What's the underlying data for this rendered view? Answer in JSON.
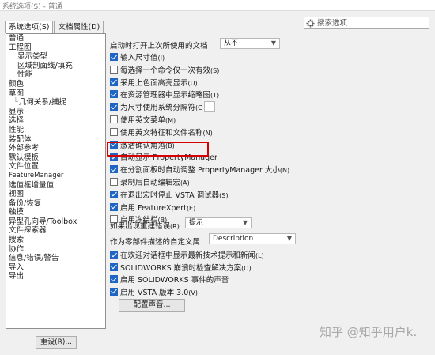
{
  "window": {
    "title": "系统选项(S) - 普通"
  },
  "tabs": [
    {
      "label": "系统选项(S)",
      "active": true
    },
    {
      "label": "文档属性(D)",
      "active": false
    }
  ],
  "search": {
    "placeholder": "搜索选项",
    "icon": "gear-icon"
  },
  "tree": {
    "items": [
      {
        "label": "普通",
        "level": 0
      },
      {
        "label": "工程图",
        "level": 0
      },
      {
        "label": "显示类型",
        "level": 1
      },
      {
        "label": "区域剖面线/填充",
        "level": 1
      },
      {
        "label": "性能",
        "level": 1
      },
      {
        "label": "颜色",
        "level": 0
      },
      {
        "label": "草图",
        "level": 0
      },
      {
        "label": "几何关系/捕捉",
        "level": 1,
        "connector": true
      },
      {
        "label": "显示",
        "level": 0
      },
      {
        "label": "选择",
        "level": 0
      },
      {
        "label": "性能",
        "level": 0
      },
      {
        "label": "装配体",
        "level": 0
      },
      {
        "label": "外部参考",
        "level": 0
      },
      {
        "label": "默认模板",
        "level": 0
      },
      {
        "label": "文件位置",
        "level": 0
      },
      {
        "label": "FeatureManager",
        "level": 0,
        "small": true
      },
      {
        "label": "选值框增量值",
        "level": 0
      },
      {
        "label": "视图",
        "level": 0
      },
      {
        "label": "备份/恢复",
        "level": 0
      },
      {
        "label": "触摸",
        "level": 0
      },
      {
        "label": "异型孔向导/Toolbox",
        "level": 0
      },
      {
        "label": "文件探索器",
        "level": 0
      },
      {
        "label": "搜索",
        "level": 0
      },
      {
        "label": "协作",
        "level": 0
      },
      {
        "label": "信息/错误/警告",
        "level": 0
      },
      {
        "label": "导入",
        "level": 0
      },
      {
        "label": "导出",
        "level": 0
      }
    ],
    "reset_label": "重设(R)..."
  },
  "panel": {
    "open_last_docs_label": "启动时打开上次所使用的文档",
    "open_last_docs_value": "从不",
    "checkboxes": [
      {
        "label": "输入尺寸值",
        "suffix": "(I)",
        "checked": true
      },
      {
        "label": "每选择一个命令仅一次有效",
        "suffix": "(S)",
        "checked": false
      },
      {
        "label": "采用上色面高亮显示",
        "suffix": "(U)",
        "checked": true
      },
      {
        "label": "在资源管理器中显示缩略图",
        "suffix": "(T)",
        "checked": true
      },
      {
        "label": "为尺寸使用系统分隔符",
        "suffix": "(C",
        "checked": true,
        "spin": true
      },
      {
        "label": "使用英文菜单",
        "suffix": "(M)",
        "checked": false
      },
      {
        "label": "使用英文特征和文件名称",
        "suffix": "(N)",
        "checked": false
      },
      {
        "label": "激活确认角落",
        "suffix": "(B)",
        "checked": true
      },
      {
        "label": "自动显示 PropertyManager",
        "suffix": "",
        "checked": true
      },
      {
        "label": "在分割面板时自动调整 PropertyManager 大小",
        "suffix": "(N)",
        "checked": true
      },
      {
        "label": "录制后自动编辑宏",
        "suffix": "(A)",
        "checked": false
      },
      {
        "label": "在退出宏时停止 VSTA 调试器",
        "suffix": "(S)",
        "checked": true
      },
      {
        "label": "启用 FeatureXpert",
        "suffix": "(E)",
        "checked": true
      },
      {
        "label": "启用冻结栏",
        "suffix": "(B)",
        "checked": false
      }
    ],
    "rebuild_error_label": "如果出现重建错误",
    "rebuild_error_suffix": "(R)",
    "rebuild_error_value": "提示",
    "custom_prop_label": "作为零部件描述的自定义属",
    "custom_prop_value": "Description",
    "checkboxes2": [
      {
        "label": "在欢迎对话框中显示最新技术提示和新闻",
        "suffix": "(L)",
        "checked": true
      },
      {
        "label": "SOLIDWORKS 崩溃时检查解决方案",
        "suffix": "(O)",
        "checked": true
      },
      {
        "label": "启用 SOLIDWORKS 事件的声音",
        "suffix": "",
        "checked": true
      },
      {
        "label": "启用 VSTA 版本 3.0",
        "suffix": "(V)",
        "checked": true
      }
    ],
    "sounds_button": "配置声音..."
  },
  "watermark": "知乎 @知乎用户k."
}
